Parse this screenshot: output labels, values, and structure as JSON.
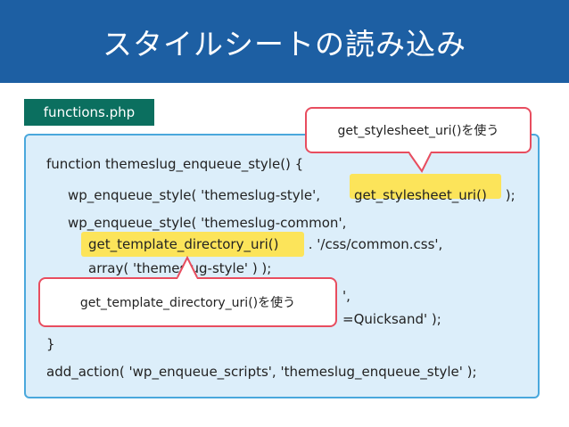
{
  "header": {
    "title": "スタイルシートの読み込み"
  },
  "file_tab": {
    "label": "functions.php"
  },
  "code": {
    "line1": "function themeslug_enqueue_style() {",
    "line2_prefix": "wp_enqueue_style( 'themeslug-style', ",
    "line2_highlight": "get_stylesheet_uri()",
    "line2_suffix": " );",
    "line3": "wp_enqueue_style( 'themeslug-common',",
    "line4_highlight": "get_template_directory_uri()",
    "line4_suffix": " . '/css/common.css',",
    "line5": "array( 'themeslug-style' ) );",
    "line6_partial": "',",
    "line7_partial": "=Quicksand' );",
    "line8": "}",
    "line9": "add_action( 'wp_enqueue_scripts', 'themeslug_enqueue_style' );"
  },
  "callouts": {
    "stylesheet": "get_stylesheet_uri()を使う",
    "template": "get_template_directory_uri()を使う"
  },
  "colors": {
    "header_bg": "#1d5fa3",
    "tab_bg": "#0b6f5f",
    "code_bg": "#dceefa",
    "code_border": "#4aa8dc",
    "highlight": "#fce45a",
    "callout_border": "#e84d5f"
  }
}
